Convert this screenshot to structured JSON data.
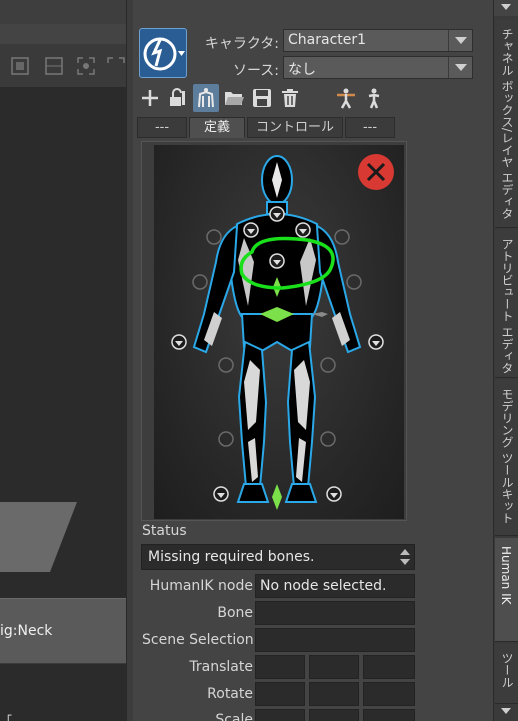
{
  "left_panel": {
    "neck_node_label": "ig:Neck",
    "bottom_text": "                     「"
  },
  "hik": {
    "character_label": "キャラクタ:",
    "character_value": "Character1",
    "source_label": "ソース:",
    "source_value": "なし",
    "toolbar_icons": [
      "add-icon",
      "unlock-icon",
      "skeleton-icon",
      "folder-icon",
      "save-icon",
      "delete-icon",
      "tpose-icon",
      "character-icon"
    ],
    "tabs": [
      {
        "label": "---",
        "active": false
      },
      {
        "label": "定義",
        "active": true
      },
      {
        "label": "コントロール",
        "active": false
      },
      {
        "label": "---",
        "active": false
      }
    ],
    "status_label": "Status",
    "status_value": "Missing required bones.",
    "properties": [
      {
        "label": "HumanIK node",
        "value": "No node selected."
      },
      {
        "label": "Bone",
        "value": ""
      },
      {
        "label": "Scene Selection",
        "value": ""
      },
      {
        "label": "Translate",
        "value": ""
      },
      {
        "label": "Rotate",
        "value": ""
      },
      {
        "label": "Scale",
        "value": ""
      }
    ],
    "colors": {
      "bone_active": "#7be04a",
      "body_outline": "#2aa8e8",
      "annotation": "#19e01a",
      "close_button": "#d83a33"
    }
  },
  "side_tabs": [
    {
      "label": "チャネル ボックス/レイヤ エディタ",
      "active": false
    },
    {
      "label": "アトリビュート エディタ",
      "active": false
    },
    {
      "label": "モデリング ツールキット",
      "active": false
    },
    {
      "label": "Human IK",
      "active": true
    },
    {
      "label": "ツール",
      "active": false
    }
  ]
}
